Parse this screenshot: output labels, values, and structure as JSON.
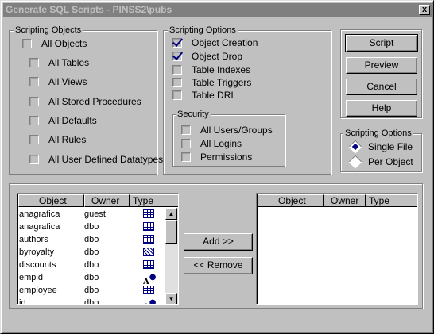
{
  "window": {
    "title": "Generate SQL Scripts - PINSS2\\pubs",
    "close_glyph": "x"
  },
  "scripting_objects": {
    "legend": "Scripting Objects",
    "all_objects": "All Objects",
    "items": [
      "All Tables",
      "All Views",
      "All Stored Procedures",
      "All Defaults",
      "All Rules",
      "All User Defined Datatypes"
    ]
  },
  "scripting_options": {
    "legend": "Scripting Options",
    "object_creation": "Object Creation",
    "object_drop": "Object Drop",
    "table_indexes": "Table Indexes",
    "table_triggers": "Table Triggers",
    "table_dri": "Table DRI",
    "security": {
      "legend": "Security",
      "all_users_groups": "All Users/Groups",
      "all_logins": "All Logins",
      "permissions": "Permissions"
    }
  },
  "buttons": {
    "script": "Script",
    "preview": "Preview",
    "cancel": "Cancel",
    "help": "Help",
    "add": "Add >>",
    "remove": "<< Remove"
  },
  "file_options": {
    "legend": "Scripting Options",
    "single_file": "Single File",
    "per_object": "Per Object"
  },
  "columns": {
    "object": "Object",
    "owner": "Owner",
    "type": "Type"
  },
  "objects": [
    {
      "name": "anagrafica",
      "owner": "guest",
      "type_icon": "table-icon"
    },
    {
      "name": "anagrafica",
      "owner": "dbo",
      "type_icon": "table-icon"
    },
    {
      "name": "authors",
      "owner": "dbo",
      "type_icon": "table-icon"
    },
    {
      "name": "byroyalty",
      "owner": "dbo",
      "type_icon": "view-icon"
    },
    {
      "name": "discounts",
      "owner": "dbo",
      "type_icon": "table-icon"
    },
    {
      "name": "empid",
      "owner": "dbo",
      "type_icon": "datatype-icon"
    },
    {
      "name": "employee",
      "owner": "dbo",
      "type_icon": "table-icon"
    },
    {
      "name": "id",
      "owner": "dbo",
      "type_icon": "datatype-icon"
    }
  ],
  "colors": {
    "accent": "#000080",
    "face": "#c0c0c0"
  }
}
